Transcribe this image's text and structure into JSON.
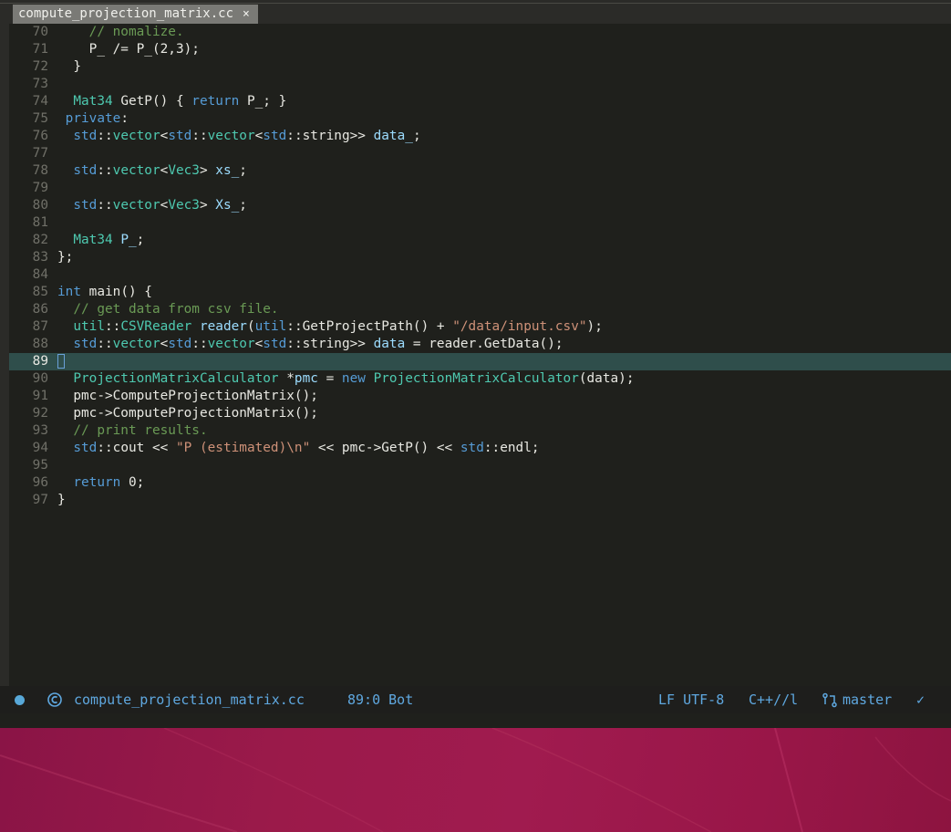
{
  "tab": {
    "filename": "compute_projection_matrix.cc",
    "close": "×"
  },
  "editor": {
    "current_line": "89",
    "lines": [
      {
        "n": "70",
        "tokens": [
          [
            "plain",
            "    "
          ],
          [
            "comment",
            "// nomalize."
          ]
        ]
      },
      {
        "n": "71",
        "tokens": [
          [
            "plain",
            "    P_ /= P_(2,3);"
          ]
        ]
      },
      {
        "n": "72",
        "tokens": [
          [
            "plain",
            "  }"
          ]
        ]
      },
      {
        "n": "73",
        "tokens": []
      },
      {
        "n": "74",
        "tokens": [
          [
            "plain",
            "  "
          ],
          [
            "type",
            "Mat34"
          ],
          [
            "plain",
            " GetP() { "
          ],
          [
            "keyword",
            "return"
          ],
          [
            "plain",
            " P_; }"
          ]
        ]
      },
      {
        "n": "75",
        "tokens": [
          [
            "plain",
            " "
          ],
          [
            "keyword",
            "private"
          ],
          [
            "plain",
            ":"
          ]
        ]
      },
      {
        "n": "76",
        "tokens": [
          [
            "plain",
            "  "
          ],
          [
            "keyword",
            "std"
          ],
          [
            "plain",
            "::"
          ],
          [
            "type",
            "vector"
          ],
          [
            "plain",
            "<"
          ],
          [
            "keyword",
            "std"
          ],
          [
            "plain",
            "::"
          ],
          [
            "type",
            "vector"
          ],
          [
            "plain",
            "<"
          ],
          [
            "keyword",
            "std"
          ],
          [
            "plain",
            "::string>> "
          ],
          [
            "ident",
            "data_"
          ],
          [
            "plain",
            ";"
          ]
        ]
      },
      {
        "n": "77",
        "tokens": []
      },
      {
        "n": "78",
        "tokens": [
          [
            "plain",
            "  "
          ],
          [
            "keyword",
            "std"
          ],
          [
            "plain",
            "::"
          ],
          [
            "type",
            "vector"
          ],
          [
            "plain",
            "<"
          ],
          [
            "type",
            "Vec3"
          ],
          [
            "plain",
            "> "
          ],
          [
            "ident",
            "xs_"
          ],
          [
            "plain",
            ";"
          ]
        ]
      },
      {
        "n": "79",
        "tokens": []
      },
      {
        "n": "80",
        "tokens": [
          [
            "plain",
            "  "
          ],
          [
            "keyword",
            "std"
          ],
          [
            "plain",
            "::"
          ],
          [
            "type",
            "vector"
          ],
          [
            "plain",
            "<"
          ],
          [
            "type",
            "Vec3"
          ],
          [
            "plain",
            "> "
          ],
          [
            "ident",
            "Xs_"
          ],
          [
            "plain",
            ";"
          ]
        ]
      },
      {
        "n": "81",
        "tokens": []
      },
      {
        "n": "82",
        "tokens": [
          [
            "plain",
            "  "
          ],
          [
            "type",
            "Mat34"
          ],
          [
            "plain",
            " "
          ],
          [
            "ident",
            "P_"
          ],
          [
            "plain",
            ";"
          ]
        ]
      },
      {
        "n": "83",
        "tokens": [
          [
            "plain",
            "};"
          ]
        ]
      },
      {
        "n": "84",
        "tokens": []
      },
      {
        "n": "85",
        "tokens": [
          [
            "keyword",
            "int"
          ],
          [
            "plain",
            " main() {"
          ]
        ]
      },
      {
        "n": "86",
        "tokens": [
          [
            "plain",
            "  "
          ],
          [
            "comment",
            "// get data from csv file."
          ]
        ]
      },
      {
        "n": "87",
        "tokens": [
          [
            "plain",
            "  "
          ],
          [
            "type",
            "util"
          ],
          [
            "plain",
            "::"
          ],
          [
            "type",
            "CSVReader"
          ],
          [
            "plain",
            " "
          ],
          [
            "ident",
            "reader"
          ],
          [
            "plain",
            "("
          ],
          [
            "keyword",
            "util"
          ],
          [
            "plain",
            "::GetProjectPath() + "
          ],
          [
            "string",
            "\"/data/input.csv\""
          ],
          [
            "plain",
            ");"
          ]
        ]
      },
      {
        "n": "88",
        "tokens": [
          [
            "plain",
            "  "
          ],
          [
            "keyword",
            "std"
          ],
          [
            "plain",
            "::"
          ],
          [
            "type",
            "vector"
          ],
          [
            "plain",
            "<"
          ],
          [
            "keyword",
            "std"
          ],
          [
            "plain",
            "::"
          ],
          [
            "type",
            "vector"
          ],
          [
            "plain",
            "<"
          ],
          [
            "keyword",
            "std"
          ],
          [
            "plain",
            "::string>> "
          ],
          [
            "ident",
            "data"
          ],
          [
            "plain",
            " = reader.GetData();"
          ]
        ]
      },
      {
        "n": "89",
        "tokens": []
      },
      {
        "n": "90",
        "tokens": [
          [
            "plain",
            "  "
          ],
          [
            "type",
            "ProjectionMatrixCalculator"
          ],
          [
            "plain",
            " *"
          ],
          [
            "ident",
            "pmc"
          ],
          [
            "plain",
            " = "
          ],
          [
            "keyword",
            "new"
          ],
          [
            "plain",
            " "
          ],
          [
            "type",
            "ProjectionMatrixCalculator"
          ],
          [
            "plain",
            "(data);"
          ]
        ]
      },
      {
        "n": "91",
        "tokens": [
          [
            "plain",
            "  pmc->ComputeProjectionMatrix();"
          ]
        ]
      },
      {
        "n": "92",
        "tokens": [
          [
            "plain",
            "  pmc->ComputeProjectionMatrix();"
          ]
        ]
      },
      {
        "n": "93",
        "tokens": [
          [
            "plain",
            "  "
          ],
          [
            "comment",
            "// print results."
          ]
        ]
      },
      {
        "n": "94",
        "tokens": [
          [
            "plain",
            "  "
          ],
          [
            "keyword",
            "std"
          ],
          [
            "plain",
            "::cout << "
          ],
          [
            "string",
            "\"P (estimated)\\n\""
          ],
          [
            "plain",
            " << pmc->GetP() << "
          ],
          [
            "keyword",
            "std"
          ],
          [
            "plain",
            "::endl;"
          ]
        ]
      },
      {
        "n": "95",
        "tokens": []
      },
      {
        "n": "96",
        "tokens": [
          [
            "plain",
            "  "
          ],
          [
            "keyword",
            "return"
          ],
          [
            "plain",
            " 0;"
          ]
        ]
      },
      {
        "n": "97",
        "tokens": [
          [
            "plain",
            "}"
          ]
        ]
      }
    ]
  },
  "statusbar": {
    "filename": "compute_projection_matrix.cc",
    "position": "89:0 Bot",
    "encoding": "LF UTF-8",
    "mode": "C++//l",
    "branch": "master",
    "check": "✓"
  },
  "colors": {
    "accent": "#5fa8e0",
    "current_line_bg": "#2f4e4b",
    "desktop": "#9b1a4a"
  }
}
